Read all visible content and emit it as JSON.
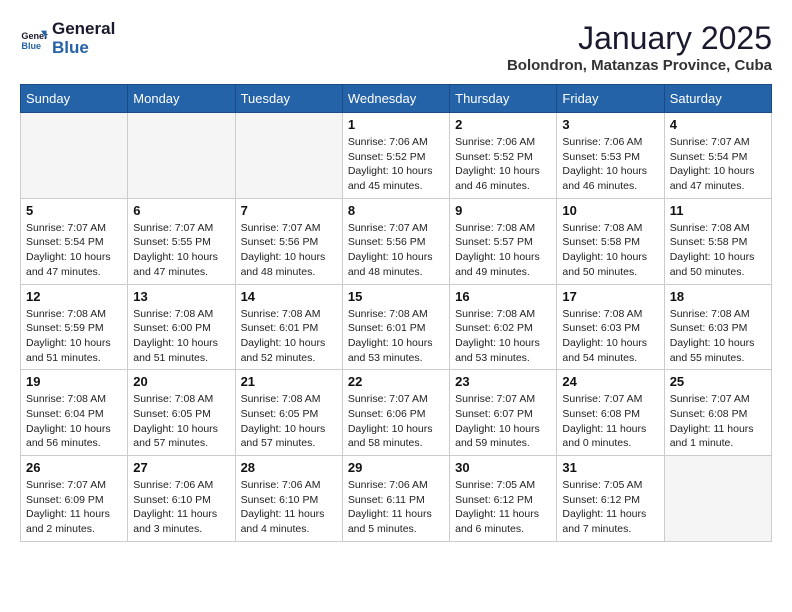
{
  "header": {
    "logo_line1": "General",
    "logo_line2": "Blue",
    "month_title": "January 2025",
    "subtitle": "Bolondron, Matanzas Province, Cuba"
  },
  "weekdays": [
    "Sunday",
    "Monday",
    "Tuesday",
    "Wednesday",
    "Thursday",
    "Friday",
    "Saturday"
  ],
  "weeks": [
    [
      {
        "day": "",
        "info": ""
      },
      {
        "day": "",
        "info": ""
      },
      {
        "day": "",
        "info": ""
      },
      {
        "day": "1",
        "info": "Sunrise: 7:06 AM\nSunset: 5:52 PM\nDaylight: 10 hours\nand 45 minutes."
      },
      {
        "day": "2",
        "info": "Sunrise: 7:06 AM\nSunset: 5:52 PM\nDaylight: 10 hours\nand 46 minutes."
      },
      {
        "day": "3",
        "info": "Sunrise: 7:06 AM\nSunset: 5:53 PM\nDaylight: 10 hours\nand 46 minutes."
      },
      {
        "day": "4",
        "info": "Sunrise: 7:07 AM\nSunset: 5:54 PM\nDaylight: 10 hours\nand 47 minutes."
      }
    ],
    [
      {
        "day": "5",
        "info": "Sunrise: 7:07 AM\nSunset: 5:54 PM\nDaylight: 10 hours\nand 47 minutes."
      },
      {
        "day": "6",
        "info": "Sunrise: 7:07 AM\nSunset: 5:55 PM\nDaylight: 10 hours\nand 47 minutes."
      },
      {
        "day": "7",
        "info": "Sunrise: 7:07 AM\nSunset: 5:56 PM\nDaylight: 10 hours\nand 48 minutes."
      },
      {
        "day": "8",
        "info": "Sunrise: 7:07 AM\nSunset: 5:56 PM\nDaylight: 10 hours\nand 48 minutes."
      },
      {
        "day": "9",
        "info": "Sunrise: 7:08 AM\nSunset: 5:57 PM\nDaylight: 10 hours\nand 49 minutes."
      },
      {
        "day": "10",
        "info": "Sunrise: 7:08 AM\nSunset: 5:58 PM\nDaylight: 10 hours\nand 50 minutes."
      },
      {
        "day": "11",
        "info": "Sunrise: 7:08 AM\nSunset: 5:58 PM\nDaylight: 10 hours\nand 50 minutes."
      }
    ],
    [
      {
        "day": "12",
        "info": "Sunrise: 7:08 AM\nSunset: 5:59 PM\nDaylight: 10 hours\nand 51 minutes."
      },
      {
        "day": "13",
        "info": "Sunrise: 7:08 AM\nSunset: 6:00 PM\nDaylight: 10 hours\nand 51 minutes."
      },
      {
        "day": "14",
        "info": "Sunrise: 7:08 AM\nSunset: 6:01 PM\nDaylight: 10 hours\nand 52 minutes."
      },
      {
        "day": "15",
        "info": "Sunrise: 7:08 AM\nSunset: 6:01 PM\nDaylight: 10 hours\nand 53 minutes."
      },
      {
        "day": "16",
        "info": "Sunrise: 7:08 AM\nSunset: 6:02 PM\nDaylight: 10 hours\nand 53 minutes."
      },
      {
        "day": "17",
        "info": "Sunrise: 7:08 AM\nSunset: 6:03 PM\nDaylight: 10 hours\nand 54 minutes."
      },
      {
        "day": "18",
        "info": "Sunrise: 7:08 AM\nSunset: 6:03 PM\nDaylight: 10 hours\nand 55 minutes."
      }
    ],
    [
      {
        "day": "19",
        "info": "Sunrise: 7:08 AM\nSunset: 6:04 PM\nDaylight: 10 hours\nand 56 minutes."
      },
      {
        "day": "20",
        "info": "Sunrise: 7:08 AM\nSunset: 6:05 PM\nDaylight: 10 hours\nand 57 minutes."
      },
      {
        "day": "21",
        "info": "Sunrise: 7:08 AM\nSunset: 6:05 PM\nDaylight: 10 hours\nand 57 minutes."
      },
      {
        "day": "22",
        "info": "Sunrise: 7:07 AM\nSunset: 6:06 PM\nDaylight: 10 hours\nand 58 minutes."
      },
      {
        "day": "23",
        "info": "Sunrise: 7:07 AM\nSunset: 6:07 PM\nDaylight: 10 hours\nand 59 minutes."
      },
      {
        "day": "24",
        "info": "Sunrise: 7:07 AM\nSunset: 6:08 PM\nDaylight: 11 hours\nand 0 minutes."
      },
      {
        "day": "25",
        "info": "Sunrise: 7:07 AM\nSunset: 6:08 PM\nDaylight: 11 hours\nand 1 minute."
      }
    ],
    [
      {
        "day": "26",
        "info": "Sunrise: 7:07 AM\nSunset: 6:09 PM\nDaylight: 11 hours\nand 2 minutes."
      },
      {
        "day": "27",
        "info": "Sunrise: 7:06 AM\nSunset: 6:10 PM\nDaylight: 11 hours\nand 3 minutes."
      },
      {
        "day": "28",
        "info": "Sunrise: 7:06 AM\nSunset: 6:10 PM\nDaylight: 11 hours\nand 4 minutes."
      },
      {
        "day": "29",
        "info": "Sunrise: 7:06 AM\nSunset: 6:11 PM\nDaylight: 11 hours\nand 5 minutes."
      },
      {
        "day": "30",
        "info": "Sunrise: 7:05 AM\nSunset: 6:12 PM\nDaylight: 11 hours\nand 6 minutes."
      },
      {
        "day": "31",
        "info": "Sunrise: 7:05 AM\nSunset: 6:12 PM\nDaylight: 11 hours\nand 7 minutes."
      },
      {
        "day": "",
        "info": ""
      }
    ]
  ]
}
